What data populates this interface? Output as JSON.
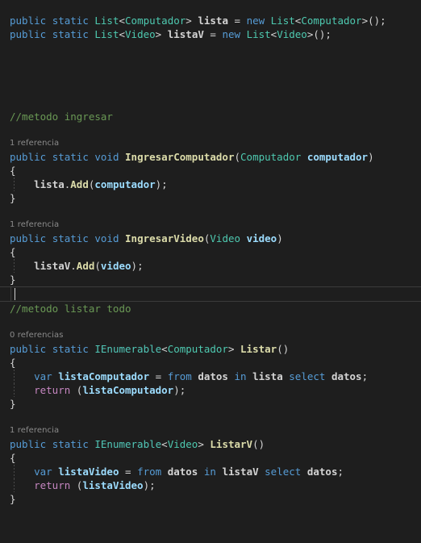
{
  "editor": {
    "language": "csharp",
    "background_color": "#1e1e1e",
    "theme": "dark-plus",
    "cursor_line_index": 21,
    "colors": {
      "keyword": "#569cd6",
      "control_keyword": "#c586c0",
      "type": "#4ec9b0",
      "interface": "#51c7b8",
      "method": "#dcdcaa",
      "variable": "#9cdcfe",
      "identifier": "#d4d4d4",
      "comment": "#6a9955",
      "codelens": "#8b8b8b",
      "punctuation": "#d4d4d4",
      "current_line_border": "#3b3b3b",
      "indent_guide": "#4a4a4a"
    }
  },
  "code_lines": [
    {
      "kind": "blank",
      "tokens": []
    },
    {
      "kind": "code",
      "tokens": [
        {
          "t": "public",
          "c": "kw"
        },
        {
          "t": " ",
          "c": "plain"
        },
        {
          "t": "static",
          "c": "kw"
        },
        {
          "t": " ",
          "c": "plain"
        },
        {
          "t": "List",
          "c": "type"
        },
        {
          "t": "<",
          "c": "plain"
        },
        {
          "t": "Computador",
          "c": "type"
        },
        {
          "t": "> ",
          "c": "plain"
        },
        {
          "t": "lista",
          "c": "id"
        },
        {
          "t": " = ",
          "c": "plain"
        },
        {
          "t": "new",
          "c": "kw"
        },
        {
          "t": " ",
          "c": "plain"
        },
        {
          "t": "List",
          "c": "type"
        },
        {
          "t": "<",
          "c": "plain"
        },
        {
          "t": "Computador",
          "c": "type"
        },
        {
          "t": ">();",
          "c": "plain"
        }
      ]
    },
    {
      "kind": "code",
      "tokens": [
        {
          "t": "public",
          "c": "kw"
        },
        {
          "t": " ",
          "c": "plain"
        },
        {
          "t": "static",
          "c": "kw"
        },
        {
          "t": " ",
          "c": "plain"
        },
        {
          "t": "List",
          "c": "type"
        },
        {
          "t": "<",
          "c": "plain"
        },
        {
          "t": "Video",
          "c": "type"
        },
        {
          "t": "> ",
          "c": "plain"
        },
        {
          "t": "listaV",
          "c": "id"
        },
        {
          "t": " = ",
          "c": "plain"
        },
        {
          "t": "new",
          "c": "kw"
        },
        {
          "t": " ",
          "c": "plain"
        },
        {
          "t": "List",
          "c": "type"
        },
        {
          "t": "<",
          "c": "plain"
        },
        {
          "t": "Video",
          "c": "type"
        },
        {
          "t": ">();",
          "c": "plain"
        }
      ]
    },
    {
      "kind": "blank",
      "tokens": []
    },
    {
      "kind": "blank",
      "tokens": []
    },
    {
      "kind": "blank",
      "tokens": []
    },
    {
      "kind": "blank",
      "tokens": []
    },
    {
      "kind": "blank",
      "tokens": []
    },
    {
      "kind": "code",
      "tokens": [
        {
          "t": "//metodo ingresar",
          "c": "cmt"
        }
      ]
    },
    {
      "kind": "blank",
      "tokens": []
    },
    {
      "kind": "codelens",
      "text": "1 referencia"
    },
    {
      "kind": "code",
      "tokens": [
        {
          "t": "public",
          "c": "kw"
        },
        {
          "t": " ",
          "c": "plain"
        },
        {
          "t": "static",
          "c": "kw"
        },
        {
          "t": " ",
          "c": "plain"
        },
        {
          "t": "void",
          "c": "kw"
        },
        {
          "t": " ",
          "c": "plain"
        },
        {
          "t": "IngresarComputador",
          "c": "meth"
        },
        {
          "t": "(",
          "c": "plain"
        },
        {
          "t": "Computador",
          "c": "type"
        },
        {
          "t": " ",
          "c": "plain"
        },
        {
          "t": "computador",
          "c": "var"
        },
        {
          "t": ")",
          "c": "plain"
        }
      ]
    },
    {
      "kind": "code",
      "tokens": [
        {
          "t": "{",
          "c": "brace"
        }
      ]
    },
    {
      "kind": "code",
      "indent_guide": true,
      "tokens": [
        {
          "t": "    ",
          "c": "plain"
        },
        {
          "t": "lista",
          "c": "id"
        },
        {
          "t": ".",
          "c": "plain"
        },
        {
          "t": "Add",
          "c": "meth"
        },
        {
          "t": "(",
          "c": "plain"
        },
        {
          "t": "computador",
          "c": "var"
        },
        {
          "t": ");",
          "c": "plain"
        }
      ]
    },
    {
      "kind": "code",
      "tokens": [
        {
          "t": "}",
          "c": "brace"
        }
      ]
    },
    {
      "kind": "blank",
      "tokens": []
    },
    {
      "kind": "codelens",
      "text": "1 referencia"
    },
    {
      "kind": "code",
      "tokens": [
        {
          "t": "public",
          "c": "kw"
        },
        {
          "t": " ",
          "c": "plain"
        },
        {
          "t": "static",
          "c": "kw"
        },
        {
          "t": " ",
          "c": "plain"
        },
        {
          "t": "void",
          "c": "kw"
        },
        {
          "t": " ",
          "c": "plain"
        },
        {
          "t": "IngresarVideo",
          "c": "meth"
        },
        {
          "t": "(",
          "c": "plain"
        },
        {
          "t": "Video",
          "c": "type"
        },
        {
          "t": " ",
          "c": "plain"
        },
        {
          "t": "video",
          "c": "var"
        },
        {
          "t": ")",
          "c": "plain"
        }
      ]
    },
    {
      "kind": "code",
      "tokens": [
        {
          "t": "{",
          "c": "brace"
        }
      ]
    },
    {
      "kind": "code",
      "indent_guide": true,
      "tokens": [
        {
          "t": "    ",
          "c": "plain"
        },
        {
          "t": "listaV",
          "c": "id"
        },
        {
          "t": ".",
          "c": "plain"
        },
        {
          "t": "Add",
          "c": "meth"
        },
        {
          "t": "(",
          "c": "plain"
        },
        {
          "t": "video",
          "c": "var"
        },
        {
          "t": ");",
          "c": "plain"
        }
      ]
    },
    {
      "kind": "code",
      "tokens": [
        {
          "t": "}",
          "c": "brace"
        }
      ]
    },
    {
      "kind": "current",
      "tokens": []
    },
    {
      "kind": "code",
      "tokens": [
        {
          "t": "//metodo listar todo",
          "c": "cmt"
        }
      ]
    },
    {
      "kind": "blank",
      "tokens": []
    },
    {
      "kind": "codelens",
      "text": "0 referencias"
    },
    {
      "kind": "code",
      "tokens": [
        {
          "t": "public",
          "c": "kw"
        },
        {
          "t": " ",
          "c": "plain"
        },
        {
          "t": "static",
          "c": "kw"
        },
        {
          "t": " ",
          "c": "plain"
        },
        {
          "t": "IEnumerable",
          "c": "iface"
        },
        {
          "t": "<",
          "c": "plain"
        },
        {
          "t": "Computador",
          "c": "type"
        },
        {
          "t": "> ",
          "c": "plain"
        },
        {
          "t": "Listar",
          "c": "meth"
        },
        {
          "t": "()",
          "c": "plain"
        }
      ]
    },
    {
      "kind": "code",
      "tokens": [
        {
          "t": "{",
          "c": "brace"
        }
      ]
    },
    {
      "kind": "code",
      "indent_guide": true,
      "tokens": [
        {
          "t": "    ",
          "c": "plain"
        },
        {
          "t": "var",
          "c": "kw"
        },
        {
          "t": " ",
          "c": "plain"
        },
        {
          "t": "listaComputador",
          "c": "var"
        },
        {
          "t": " = ",
          "c": "plain"
        },
        {
          "t": "from",
          "c": "kw"
        },
        {
          "t": " ",
          "c": "plain"
        },
        {
          "t": "datos",
          "c": "id"
        },
        {
          "t": " ",
          "c": "plain"
        },
        {
          "t": "in",
          "c": "kw"
        },
        {
          "t": " ",
          "c": "plain"
        },
        {
          "t": "lista",
          "c": "id"
        },
        {
          "t": " ",
          "c": "plain"
        },
        {
          "t": "select",
          "c": "kw"
        },
        {
          "t": " ",
          "c": "plain"
        },
        {
          "t": "datos",
          "c": "id"
        },
        {
          "t": ";",
          "c": "plain"
        }
      ]
    },
    {
      "kind": "code",
      "indent_guide": true,
      "tokens": [
        {
          "t": "    ",
          "c": "plain"
        },
        {
          "t": "return",
          "c": "ctrl"
        },
        {
          "t": " (",
          "c": "plain"
        },
        {
          "t": "listaComputador",
          "c": "var"
        },
        {
          "t": ");",
          "c": "plain"
        }
      ]
    },
    {
      "kind": "code",
      "tokens": [
        {
          "t": "}",
          "c": "brace"
        }
      ]
    },
    {
      "kind": "blank",
      "tokens": []
    },
    {
      "kind": "codelens",
      "text": "1 referencia"
    },
    {
      "kind": "code",
      "tokens": [
        {
          "t": "public",
          "c": "kw"
        },
        {
          "t": " ",
          "c": "plain"
        },
        {
          "t": "static",
          "c": "kw"
        },
        {
          "t": " ",
          "c": "plain"
        },
        {
          "t": "IEnumerable",
          "c": "iface"
        },
        {
          "t": "<",
          "c": "plain"
        },
        {
          "t": "Video",
          "c": "type"
        },
        {
          "t": "> ",
          "c": "plain"
        },
        {
          "t": "ListarV",
          "c": "meth"
        },
        {
          "t": "()",
          "c": "plain"
        }
      ]
    },
    {
      "kind": "code",
      "tokens": [
        {
          "t": "{",
          "c": "brace"
        }
      ]
    },
    {
      "kind": "code",
      "indent_guide": true,
      "tokens": [
        {
          "t": "    ",
          "c": "plain"
        },
        {
          "t": "var",
          "c": "kw"
        },
        {
          "t": " ",
          "c": "plain"
        },
        {
          "t": "listaVideo",
          "c": "var"
        },
        {
          "t": " = ",
          "c": "plain"
        },
        {
          "t": "from",
          "c": "kw"
        },
        {
          "t": " ",
          "c": "plain"
        },
        {
          "t": "datos",
          "c": "id"
        },
        {
          "t": " ",
          "c": "plain"
        },
        {
          "t": "in",
          "c": "kw"
        },
        {
          "t": " ",
          "c": "plain"
        },
        {
          "t": "listaV",
          "c": "id"
        },
        {
          "t": " ",
          "c": "plain"
        },
        {
          "t": "select",
          "c": "kw"
        },
        {
          "t": " ",
          "c": "plain"
        },
        {
          "t": "datos",
          "c": "id"
        },
        {
          "t": ";",
          "c": "plain"
        }
      ]
    },
    {
      "kind": "code",
      "indent_guide": true,
      "tokens": [
        {
          "t": "    ",
          "c": "plain"
        },
        {
          "t": "return",
          "c": "ctrl"
        },
        {
          "t": " (",
          "c": "plain"
        },
        {
          "t": "listaVideo",
          "c": "var"
        },
        {
          "t": ");",
          "c": "plain"
        }
      ]
    },
    {
      "kind": "code",
      "tokens": [
        {
          "t": "}",
          "c": "brace"
        }
      ]
    },
    {
      "kind": "blank",
      "tokens": []
    },
    {
      "kind": "blank",
      "tokens": []
    },
    {
      "kind": "blank",
      "tokens": []
    }
  ]
}
